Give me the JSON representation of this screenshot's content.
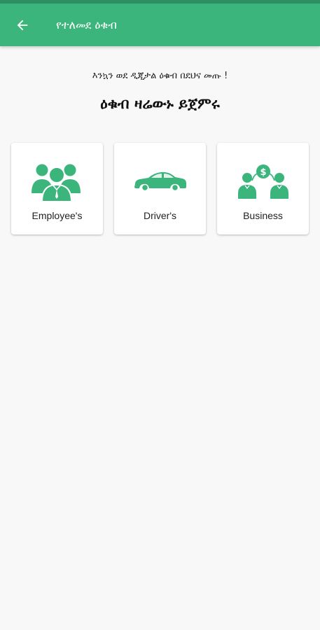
{
  "appbar": {
    "title": "የተለመደ ዕቁብ",
    "back_icon": "arrow-left-icon"
  },
  "intro": {
    "subtitle": "እንኳን ወደ ዲጂታል ዕቁብ በደህና መጡ !",
    "heading": "ዕቁብ ዛሬውኑ ይጀምሩ"
  },
  "categories": [
    {
      "label": "Employee's",
      "icon": "employees-icon"
    },
    {
      "label": "Driver's",
      "icon": "car-icon"
    },
    {
      "label": "Business",
      "icon": "business-people-money-icon"
    }
  ],
  "colors": {
    "primary": "#3bb57c",
    "status_bar": "#2e8f63",
    "background": "#f8f8f8"
  }
}
